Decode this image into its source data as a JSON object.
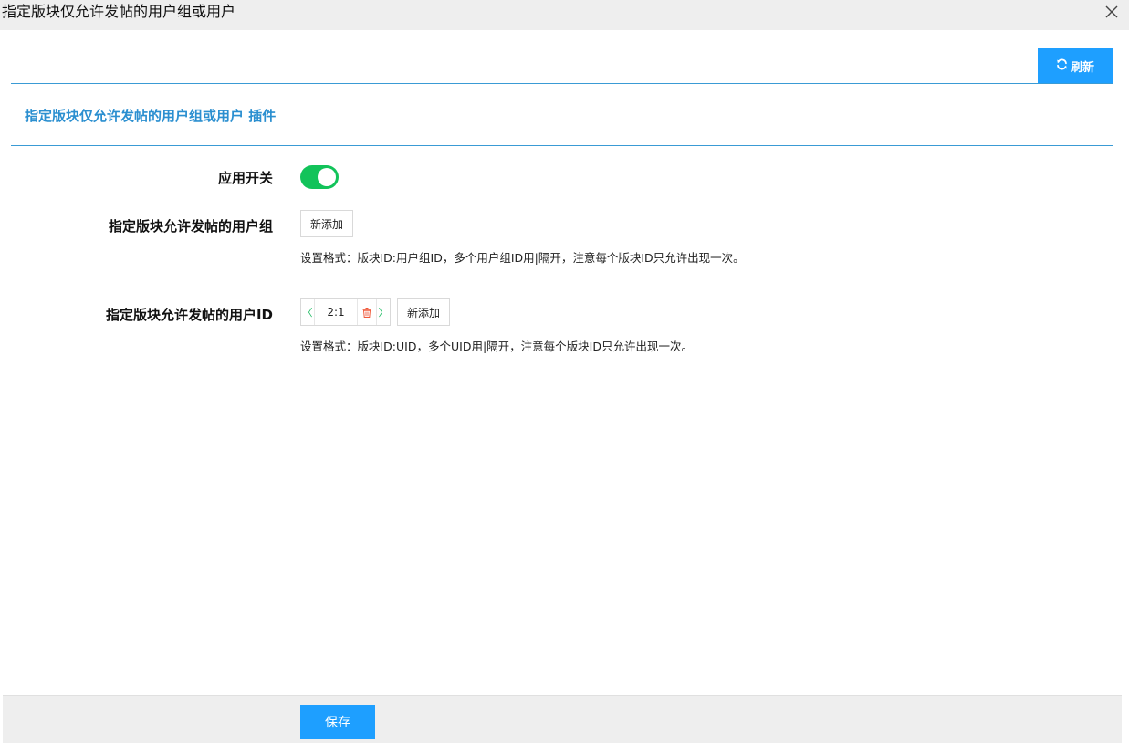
{
  "window": {
    "title": "指定版块仅允许发帖的用户组或用户",
    "close_icon": "close-icon"
  },
  "toolbar": {
    "refresh_label": "刷新",
    "refresh_icon": "refresh-icon",
    "accent_color": "#1e9fff"
  },
  "section": {
    "title": "指定版块仅允许发帖的用户组或用户 插件"
  },
  "form": {
    "app_switch": {
      "label": "应用开关",
      "enabled": true,
      "on_color": "#12c35a"
    },
    "group_field": {
      "label": "指定版块允许发帖的用户组",
      "add_label": "新添加",
      "hint": "设置格式：版块ID:用户组ID，多个用户组ID用|隔开，注意每个版块ID只允许出现一次。"
    },
    "uid_field": {
      "label": "指定版块允许发帖的用户ID",
      "items": [
        {
          "value": "2:1"
        }
      ],
      "add_label": "新添加",
      "hint": "设置格式：版块ID:UID，多个UID用|隔开，注意每个版块ID只允许出现一次。"
    }
  },
  "footer": {
    "save_label": "保存"
  }
}
